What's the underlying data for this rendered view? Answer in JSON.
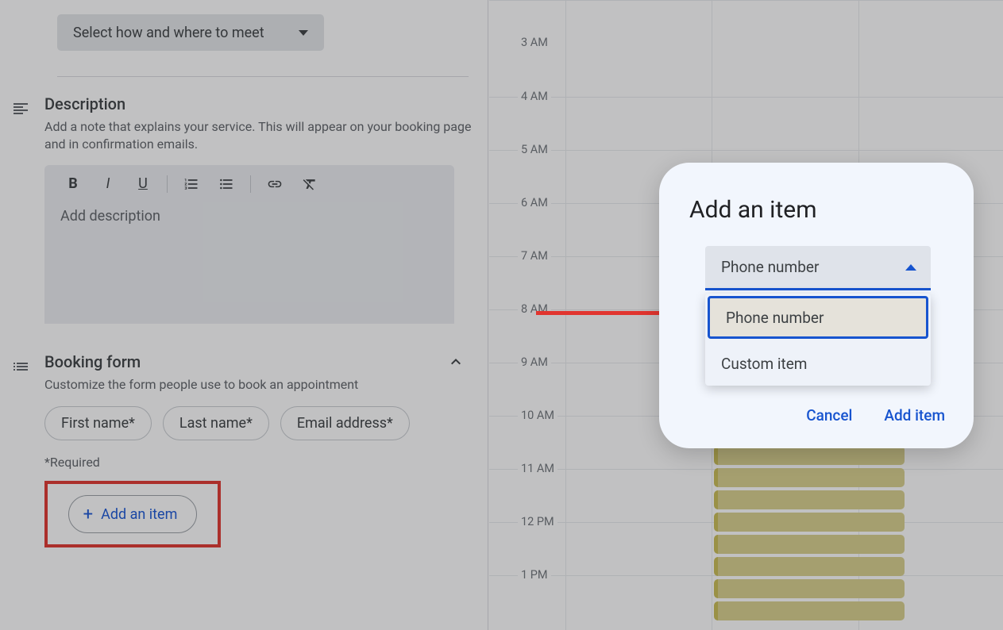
{
  "meet_dropdown": {
    "label": "Select how and where to meet"
  },
  "description": {
    "title": "Description",
    "sub": "Add a note that explains your service. This will appear on your booking page and in confirmation emails.",
    "placeholder": "Add description"
  },
  "booking_form": {
    "title": "Booking form",
    "sub": "Customize the form people use to book an appointment",
    "chips": [
      "First name*",
      "Last name*",
      "Email address*"
    ],
    "required_note": "*Required",
    "add_item_label": "Add an item"
  },
  "calendar_times": [
    "3 AM",
    "4 AM",
    "5 AM",
    "6 AM",
    "7 AM",
    "8 AM",
    "9 AM",
    "10 AM",
    "11 AM",
    "12 PM",
    "1 PM"
  ],
  "popup": {
    "title": "Add an item",
    "selected": "Phone number",
    "options": [
      "Phone number",
      "Custom item"
    ],
    "cancel": "Cancel",
    "confirm": "Add item"
  }
}
